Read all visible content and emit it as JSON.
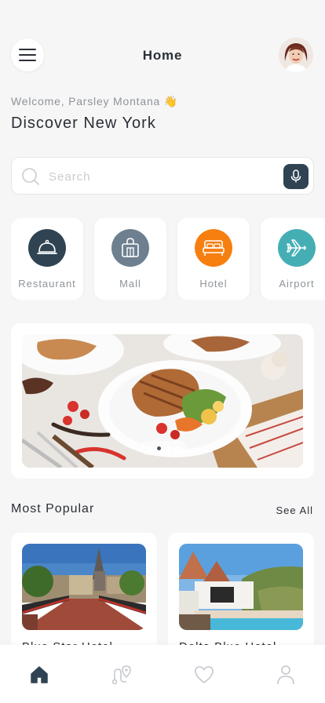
{
  "header": {
    "title": "Home",
    "menu_icon": "hamburger-menu-icon",
    "avatar": "profile-avatar"
  },
  "welcome": {
    "greeting": "Welcome, Parsley Montana 👋",
    "headline": "Discover New York"
  },
  "search": {
    "placeholder": "Search",
    "value": "",
    "icon": "search-icon",
    "voice_icon": "microphone-icon"
  },
  "categories": [
    {
      "label": "Restaurant",
      "icon": "cloche-icon",
      "color": "#2f4352"
    },
    {
      "label": "Mall",
      "icon": "shopping-bag-icon",
      "color": "#6e8090"
    },
    {
      "label": "Hotel",
      "icon": "bed-icon",
      "color": "#f77f0f"
    },
    {
      "label": "Airport",
      "icon": "airplane-icon",
      "color": "#45aeb5"
    }
  ],
  "banner": {
    "slides": 4,
    "active_slide": 2
  },
  "popular": {
    "title": "Most Popular",
    "see_all": "See All",
    "items": [
      {
        "name": "Blue Star Hotel"
      },
      {
        "name": "Delta Blue Hotel"
      }
    ]
  },
  "bottom_nav": [
    {
      "icon": "home-icon",
      "active": true
    },
    {
      "icon": "route-icon",
      "active": false
    },
    {
      "icon": "heart-icon",
      "active": false
    },
    {
      "icon": "user-icon",
      "active": false
    }
  ],
  "colors": {
    "accent": "#2f4352",
    "background": "#f6f6f7",
    "muted_text": "#8f9499"
  }
}
